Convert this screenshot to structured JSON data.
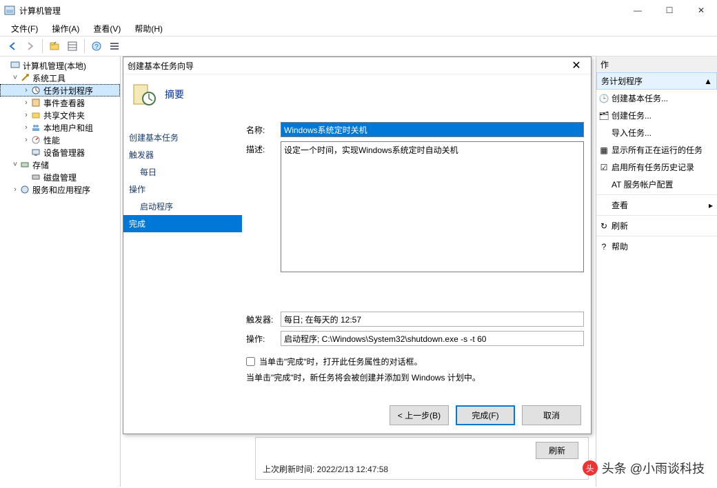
{
  "window": {
    "title": "计算机管理",
    "min": "—",
    "max": "☐",
    "close": "✕"
  },
  "menu": {
    "file": "文件(F)",
    "action": "操作(A)",
    "view": "查看(V)",
    "help": "帮助(H)"
  },
  "tree": {
    "root": "计算机管理(本地)",
    "system_tools": "系统工具",
    "task_scheduler": "任务计划程序",
    "event_viewer": "事件查看器",
    "shared_folders": "共享文件夹",
    "local_users": "本地用户和组",
    "performance": "性能",
    "device_manager": "设备管理器",
    "storage": "存储",
    "disk_mgmt": "磁盘管理",
    "services": "服务和应用程序"
  },
  "actions": {
    "header": "作",
    "section": "务计划程序",
    "create_basic": "创建基本任务...",
    "create_task": "创建任务...",
    "import": "导入任务...",
    "show_running": "显示所有正在运行的任务",
    "enable_history": "启用所有任务历史记录",
    "at_account": "AT 服务帐户配置",
    "view": "查看",
    "refresh": "刷新",
    "help": "帮助",
    "arrow": "▲",
    "chevron": "▸"
  },
  "status": {
    "last_refresh": "上次刷新时间: 2022/2/13 12:47:58",
    "refresh_btn": "刷新"
  },
  "dialog": {
    "title": "创建基本任务向导",
    "heading": "摘要",
    "nav": {
      "create": "创建基本任务",
      "trigger": "触发器",
      "trigger_daily": "每日",
      "action": "操作",
      "action_start": "启动程序",
      "finish": "完成"
    },
    "form": {
      "name_label": "名称:",
      "name_value": "Windows系统定时关机",
      "desc_label": "描述:",
      "desc_value": "设定一个时间，实现Windows系统定时自动关机",
      "trigger_label": "触发器:",
      "trigger_value": "每日; 在每天的 12:57",
      "action_label": "操作:",
      "action_value": "启动程序; C:\\Windows\\System32\\shutdown.exe -s -t 60",
      "checkbox_label": "当单击\"完成\"时，打开此任务属性的对话框。",
      "info": "当单击\"完成\"时，新任务将会被创建并添加到 Windows 计划中。"
    },
    "buttons": {
      "back": "< 上一步(B)",
      "finish": "完成(F)",
      "cancel": "取消"
    }
  },
  "watermark": "头条 @小雨谈科技",
  "icons": {
    "back": "⇦",
    "fwd": "⇨",
    "folder": "📁",
    "props": "▦",
    "help": "?",
    "list": "☰"
  }
}
